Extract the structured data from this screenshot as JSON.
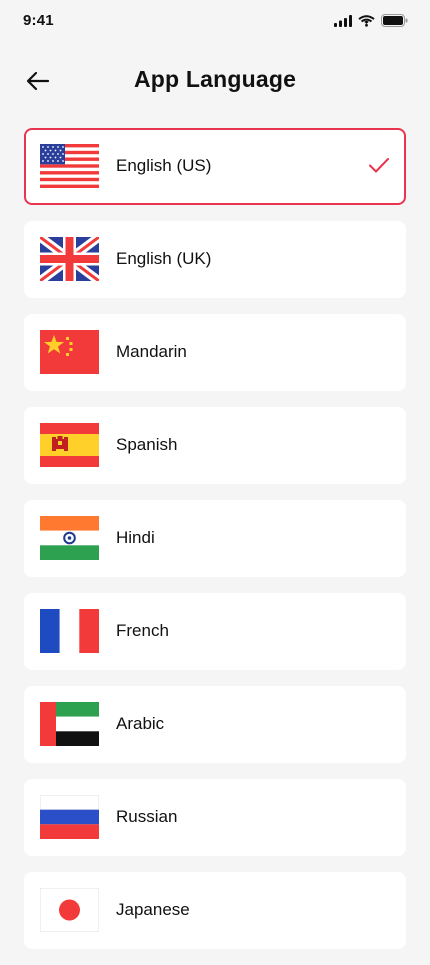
{
  "status_bar": {
    "time": "9:41"
  },
  "header": {
    "title": "App Language"
  },
  "languages": [
    {
      "label": "English (US)",
      "flag": "us-flag",
      "selected": true
    },
    {
      "label": "English (UK)",
      "flag": "uk-flag",
      "selected": false
    },
    {
      "label": "Mandarin",
      "flag": "china-flag",
      "selected": false
    },
    {
      "label": "Spanish",
      "flag": "spain-flag",
      "selected": false
    },
    {
      "label": "Hindi",
      "flag": "india-flag",
      "selected": false
    },
    {
      "label": "French",
      "flag": "france-flag",
      "selected": false
    },
    {
      "label": "Arabic",
      "flag": "uae-flag",
      "selected": false
    },
    {
      "label": "Russian",
      "flag": "russia-flag",
      "selected": false
    },
    {
      "label": "Japanese",
      "flag": "japan-flag",
      "selected": false
    }
  ],
  "colors": {
    "accent": "#e8344e",
    "background": "#f5f5f5",
    "card": "#ffffff"
  },
  "icons": {
    "back": "arrow-left-icon",
    "check": "check-icon"
  }
}
